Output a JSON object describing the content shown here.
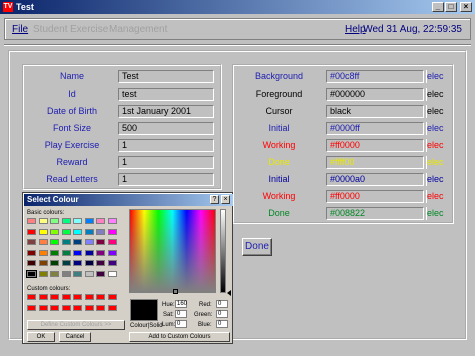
{
  "window": {
    "title": "Test"
  },
  "menubar": {
    "items": [
      {
        "label": "File",
        "enabled": true
      },
      {
        "label": "Student",
        "enabled": false
      },
      {
        "label": "Exercise",
        "enabled": false
      },
      {
        "label": "Management",
        "enabled": false
      }
    ],
    "help": "Help",
    "clock": "Wed 31 Aug, 22:59:35"
  },
  "student": {
    "fields": [
      {
        "label": "Name",
        "value": "Test"
      },
      {
        "label": "Id",
        "value": "test"
      },
      {
        "label": "Date of Birth",
        "value": "1st January 2001"
      },
      {
        "label": "Font Size",
        "value": "500"
      },
      {
        "label": "Play Exercise",
        "value": "1"
      },
      {
        "label": "Reward",
        "value": "1"
      },
      {
        "label": "Read Letters",
        "value": "1"
      }
    ]
  },
  "colours": {
    "select_label": "elec",
    "rows": [
      {
        "label": "Background",
        "value": "#00c8ff",
        "label_color": "#2020b0",
        "value_color": "#2020b0"
      },
      {
        "label": "Foreground",
        "value": "#000000",
        "label_color": "#000000",
        "value_color": "#000000"
      },
      {
        "label": "Cursor",
        "value": "black",
        "label_color": "#000000",
        "value_color": "#000000"
      },
      {
        "label": "Initial",
        "value": "#0000ff",
        "label_color": "#2020b0",
        "value_color": "#2020b0"
      },
      {
        "label": "Working",
        "value": "#ff0000",
        "label_color": "#ff0000",
        "value_color": "#ff0000"
      },
      {
        "label": "Done",
        "value": "#ffff00",
        "label_color": "#e8e800",
        "value_color": "#e8e800"
      },
      {
        "label": "Initial",
        "value": "#0000a0",
        "label_color": "#0000a0",
        "value_color": "#0000a0"
      },
      {
        "label": "Working",
        "value": "#ff0000",
        "label_color": "#ff0000",
        "value_color": "#ff0000"
      },
      {
        "label": "Done",
        "value": "#008822",
        "label_color": "#008822",
        "value_color": "#008822"
      }
    ]
  },
  "done_button": "Done",
  "dialog": {
    "title": "Select Colour",
    "basic_label": "Basic colours:",
    "custom_label": "Custom colours:",
    "define_button": "Define Custom Colours >>",
    "ok": "OK",
    "cancel": "Cancel",
    "add_custom": "Add to Custom Colours",
    "colour_solid": "Colour|Solid",
    "hue_label": "Hue:",
    "hue": "160",
    "sat_label": "Sat:",
    "sat": "0",
    "lum_label": "Lum:",
    "lum": "0",
    "red_label": "Red:",
    "red": "0",
    "green_label": "Green:",
    "green": "0",
    "blue_label": "Blue:",
    "blue": "0",
    "basic_colours": [
      "#ff8080",
      "#ffff80",
      "#80ff80",
      "#00ff80",
      "#80ffff",
      "#0080ff",
      "#ff80c0",
      "#ff80ff",
      "#ff0000",
      "#ffff00",
      "#80ff00",
      "#00ff40",
      "#00ffff",
      "#0080c0",
      "#8080c0",
      "#ff00ff",
      "#804040",
      "#ff8040",
      "#00ff00",
      "#008080",
      "#004080",
      "#8080ff",
      "#800040",
      "#ff0080",
      "#800000",
      "#ff8000",
      "#008000",
      "#008040",
      "#0000ff",
      "#0000a0",
      "#800080",
      "#8000ff",
      "#400000",
      "#804000",
      "#004000",
      "#004040",
      "#000080",
      "#000040",
      "#400040",
      "#400080",
      "#000000",
      "#808000",
      "#808040",
      "#808080",
      "#408080",
      "#c0c0c0",
      "#400040",
      "#ffffff"
    ],
    "custom_colours": [
      "#ff0000",
      "#ff0000",
      "#ff0000",
      "#ff0000",
      "#ff0000",
      "#ff0000",
      "#ff0000",
      "#ff0000",
      "#ff0000",
      "#ff0000",
      "#ff0000",
      "#ff0000",
      "#ff0000",
      "#ff0000",
      "#ff0000",
      "#ff0000"
    ]
  }
}
